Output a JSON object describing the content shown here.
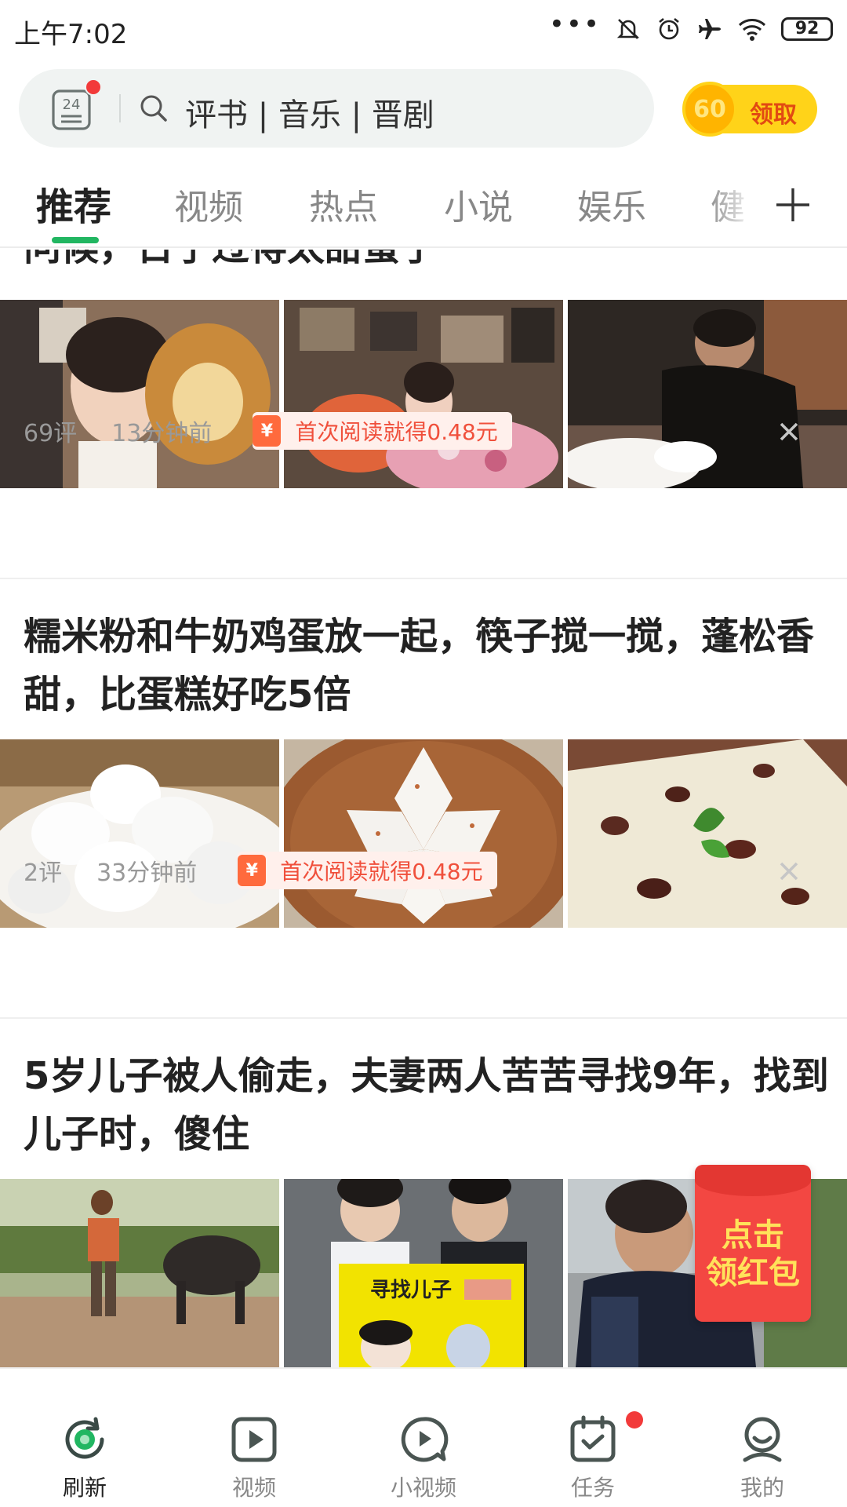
{
  "status_bar": {
    "time": "上午7:02",
    "dots": "•••",
    "battery": "92"
  },
  "header": {
    "calendar_icon_text": "24",
    "search_placeholder": "评书 | 音乐 | 晋剧",
    "reward_coin": "60",
    "reward_label": "领取"
  },
  "tabs": [
    "推荐",
    "视频",
    "热点",
    "小说",
    "娱乐",
    "健"
  ],
  "feed": [
    {
      "title": "问候，日子过得太甜蜜了",
      "comments": "69评",
      "time_ago": "13分钟前",
      "promo": "首次阅读就得0.48元"
    },
    {
      "title": "糯米粉和牛奶鸡蛋放一起，筷子搅一搅，蓬松香甜，比蛋糕好吃5倍",
      "comments": "2评",
      "time_ago": "33分钟前",
      "promo": "首次阅读就得0.48元"
    },
    {
      "title": "5岁儿子被人偷走，夫妻两人苦苦寻找9年，找到儿子时，傻住",
      "image_caption": "寻找儿子"
    }
  ],
  "promo_icon": "¥",
  "red_packet": {
    "line1": "点击",
    "line2": "领红包"
  },
  "bottom_nav": [
    "刷新",
    "视频",
    "小视频",
    "任务",
    "我的"
  ],
  "colors": {
    "accent": "#21b661",
    "badge": "#f23a3a",
    "promo_text": "#f0503c",
    "reward": "#ffd319"
  }
}
